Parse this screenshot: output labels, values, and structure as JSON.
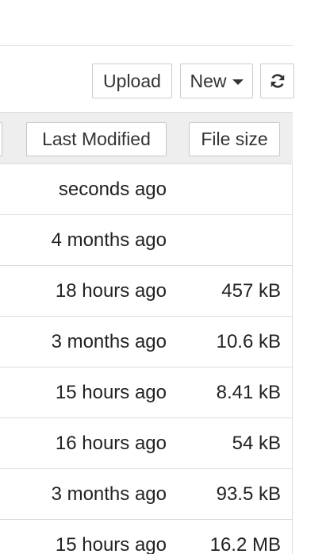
{
  "toolbar": {
    "upload_label": "Upload",
    "new_label": "New",
    "refresh_icon": "refresh-icon"
  },
  "table": {
    "headers": {
      "last_modified": "Last Modified",
      "file_size": "File size"
    },
    "rows": [
      {
        "last_modified": "seconds ago",
        "file_size": ""
      },
      {
        "last_modified": "4 months ago",
        "file_size": ""
      },
      {
        "last_modified": "18 hours ago",
        "file_size": "457 kB"
      },
      {
        "last_modified": "3 months ago",
        "file_size": "10.6 kB"
      },
      {
        "last_modified": "15 hours ago",
        "file_size": "8.41 kB"
      },
      {
        "last_modified": "16 hours ago",
        "file_size": "54 kB"
      },
      {
        "last_modified": "3 months ago",
        "file_size": "93.5 kB"
      },
      {
        "last_modified": "15 hours ago",
        "file_size": "16.2 MB"
      }
    ]
  }
}
